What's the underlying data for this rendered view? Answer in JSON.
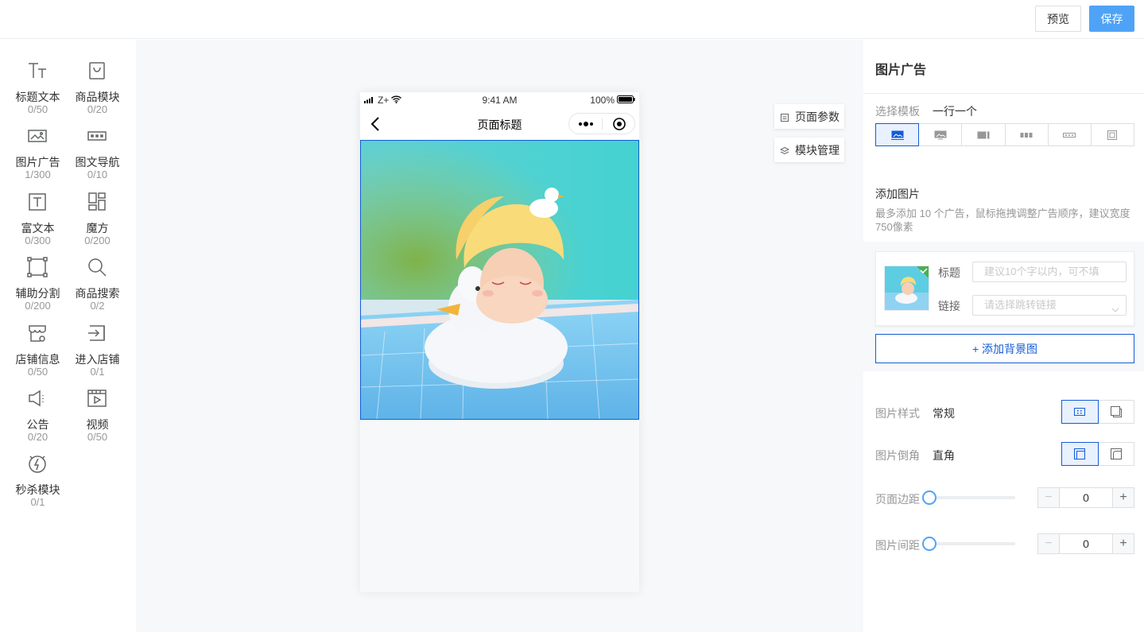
{
  "topbar": {
    "preview_label": "预览",
    "save_label": "保存"
  },
  "components": [
    {
      "label": "标题文本",
      "count": "0/50",
      "icon": "title-text-icon"
    },
    {
      "label": "商品模块",
      "count": "0/20",
      "icon": "shopping-bag-icon"
    },
    {
      "label": "图片广告",
      "count": "1/300",
      "icon": "image-ad-icon"
    },
    {
      "label": "图文导航",
      "count": "0/10",
      "icon": "image-nav-icon"
    },
    {
      "label": "富文本",
      "count": "0/300",
      "icon": "rich-text-icon"
    },
    {
      "label": "魔方",
      "count": "0/200",
      "icon": "cube-icon"
    },
    {
      "label": "辅助分割",
      "count": "0/200",
      "icon": "divider-icon"
    },
    {
      "label": "商品搜索",
      "count": "0/2",
      "icon": "search-icon"
    },
    {
      "label": "店铺信息",
      "count": "0/50",
      "icon": "store-icon"
    },
    {
      "label": "进入店铺",
      "count": "0/1",
      "icon": "enter-store-icon"
    },
    {
      "label": "公告",
      "count": "0/20",
      "icon": "announcement-icon"
    },
    {
      "label": "视频",
      "count": "0/50",
      "icon": "video-icon"
    },
    {
      "label": "秒杀模块",
      "count": "0/1",
      "icon": "flash-sale-icon"
    }
  ],
  "phone": {
    "carrier": "Z+",
    "time": "9:41 AM",
    "battery": "100%",
    "page_title": "页面标题"
  },
  "side_buttons": {
    "page_params": "页面参数",
    "module_manage": "模块管理"
  },
  "panel": {
    "title": "图片广告",
    "template_label": "选择模板",
    "template_value": "一行一个",
    "add_image_title": "添加图片",
    "add_image_hint": "最多添加 10 个广告，鼠标拖拽调整广告顺序，建议宽度750像素",
    "item": {
      "title_label": "标题",
      "title_placeholder": "建议10个字以内，可不填",
      "link_label": "链接",
      "link_placeholder": "请选择跳转链接"
    },
    "add_bg_label": "+ 添加背景图",
    "style_label": "图片样式",
    "style_value": "常规",
    "corner_label": "图片倒角",
    "corner_value": "直角",
    "page_margin_label": "页面边距",
    "page_margin_value": "0",
    "image_gap_label": "图片间距",
    "image_gap_value": "0"
  },
  "colors": {
    "accent": "#155bd4",
    "save_button": "#4fa3f7"
  }
}
